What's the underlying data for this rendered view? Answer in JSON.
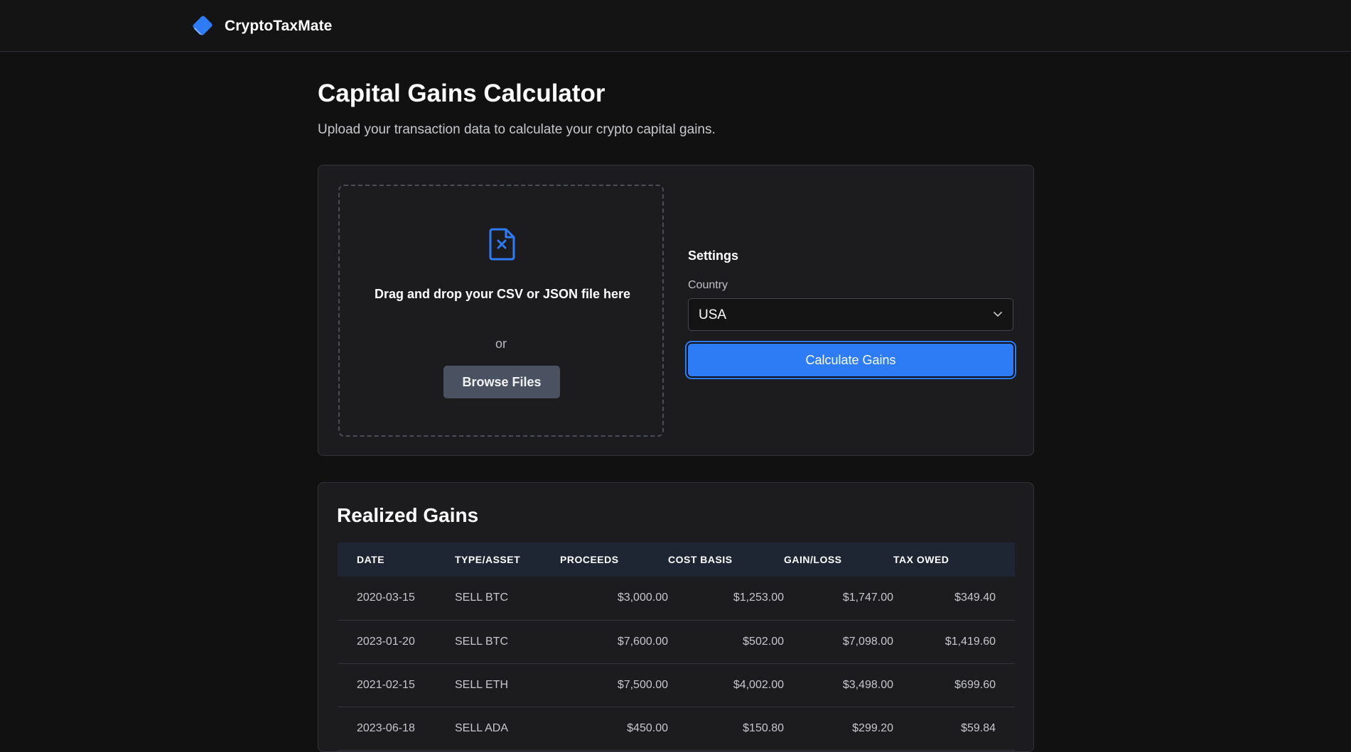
{
  "app": {
    "name": "CryptoTaxMate",
    "accent_color": "#2d7cf6",
    "logo_icon": "tag-logo-icon"
  },
  "page": {
    "title": "Capital Gains Calculator",
    "subtitle": "Upload your transaction data to calculate your crypto capital gains."
  },
  "upload": {
    "icon": "file-x-icon",
    "prompt": "Drag and drop your CSV or JSON file here",
    "or_text": "or",
    "browse_label": "Browse Files"
  },
  "settings": {
    "title": "Settings",
    "country_label": "Country",
    "country_value": "USA",
    "calculate_label": "Calculate Gains"
  },
  "gains": {
    "title": "Realized Gains",
    "columns": [
      "DATE",
      "TYPE/ASSET",
      "PROCEEDS",
      "COST BASIS",
      "GAIN/LOSS",
      "TAX OWED"
    ],
    "rows": [
      [
        "2020-03-15",
        "SELL BTC",
        "$3,000.00",
        "$1,253.00",
        "$1,747.00",
        "$349.40"
      ],
      [
        "2023-01-20",
        "SELL BTC",
        "$7,600.00",
        "$502.00",
        "$7,098.00",
        "$1,419.60"
      ],
      [
        "2021-02-15",
        "SELL ETH",
        "$7,500.00",
        "$4,002.00",
        "$3,498.00",
        "$699.60"
      ],
      [
        "2023-06-18",
        "SELL ADA",
        "$450.00",
        "$150.80",
        "$299.20",
        "$59.84"
      ]
    ]
  }
}
